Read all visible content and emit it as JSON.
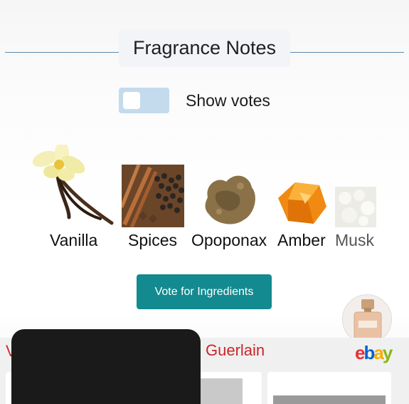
{
  "section": {
    "title": "Fragrance Notes"
  },
  "toggle": {
    "label": "Show votes",
    "on": false
  },
  "notes": [
    {
      "name": "Vanilla",
      "icon": "vanilla-flower-icon"
    },
    {
      "name": "Spices",
      "icon": "spices-icon"
    },
    {
      "name": "Opoponax",
      "icon": "opoponax-resin-icon"
    },
    {
      "name": "Amber",
      "icon": "amber-stone-icon"
    },
    {
      "name": "Musk",
      "icon": "musk-icon"
    }
  ],
  "vote_button": {
    "label": "Vote for Ingredients"
  },
  "ad": {
    "partial_text": "V",
    "brand": "Guerlain",
    "ebay_letters": [
      "e",
      "b",
      "a",
      "y"
    ],
    "ebay_colors": [
      "#e53238",
      "#0064d2",
      "#f5af02",
      "#86b817"
    ]
  },
  "colors": {
    "accent_teal": "#138a8f",
    "toggle_bg": "#c3dbed",
    "section_line": "#5b8caf"
  }
}
